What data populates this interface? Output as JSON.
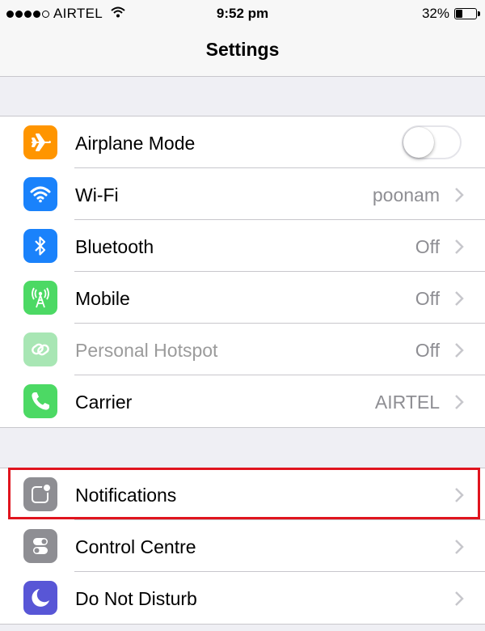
{
  "status_bar": {
    "carrier": "AIRTEL",
    "time": "9:52 pm",
    "battery": "32%",
    "battery_level": 0.32,
    "signal_bars_filled": 4,
    "signal_bars_total": 5
  },
  "nav": {
    "title": "Settings"
  },
  "group1": [
    {
      "label": "Airplane Mode",
      "icon": "airplane-icon",
      "color": "#ff9500",
      "toggle": false
    },
    {
      "label": "Wi-Fi",
      "value": "poonam",
      "icon": "wifi-icon",
      "color": "#1a82fb"
    },
    {
      "label": "Bluetooth",
      "value": "Off",
      "icon": "bluetooth-icon",
      "color": "#1a82fb"
    },
    {
      "label": "Mobile",
      "value": "Off",
      "icon": "antenna-icon",
      "color": "#4cd964"
    },
    {
      "label": "Personal Hotspot",
      "value": "Off",
      "icon": "hotspot-link-icon",
      "color": "#a8e6b4",
      "disabled": true
    },
    {
      "label": "Carrier",
      "value": "AIRTEL",
      "icon": "phone-icon",
      "color": "#4cd964"
    }
  ],
  "group2": [
    {
      "label": "Notifications",
      "icon": "notifications-icon",
      "color": "#8e8e93",
      "highlighted": true
    },
    {
      "label": "Control Centre",
      "icon": "control-centre-icon",
      "color": "#8e8e93"
    },
    {
      "label": "Do Not Disturb",
      "icon": "moon-icon",
      "color": "#5856d6"
    }
  ],
  "colors": {
    "highlight": "#e0141e",
    "background": "#efeff4"
  }
}
